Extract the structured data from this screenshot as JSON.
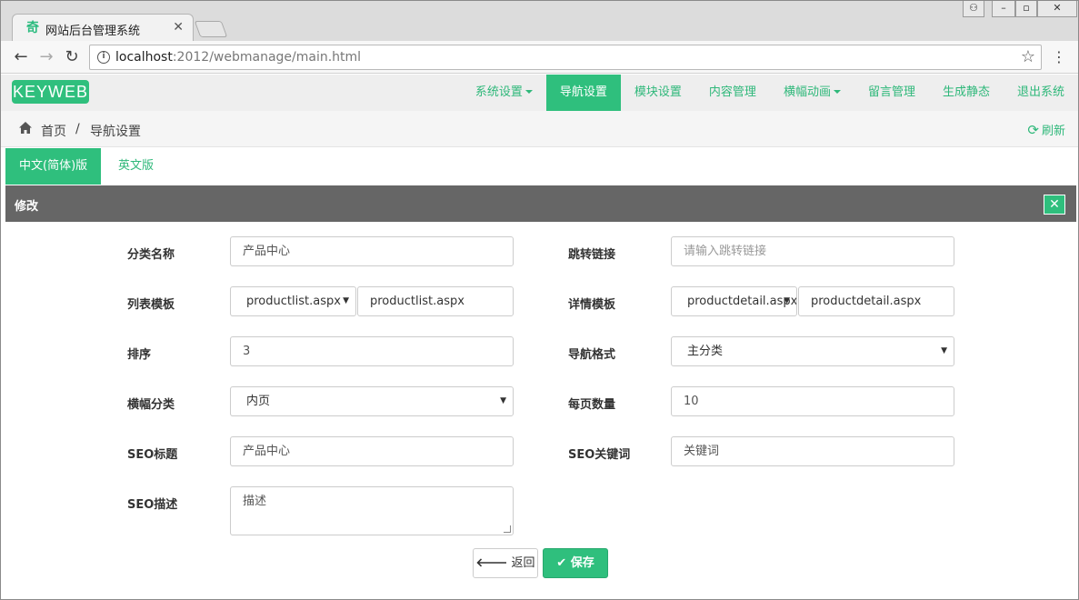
{
  "browser": {
    "tab_title": "网站后台管理系统",
    "url_host": "localhost",
    "url_path": ":2012/webmanage/main.html"
  },
  "app": {
    "logo": "KEYWEB",
    "menu": [
      {
        "label": "系统设置",
        "dropdown": true,
        "active": false
      },
      {
        "label": "导航设置",
        "dropdown": false,
        "active": true
      },
      {
        "label": "模块设置",
        "dropdown": false,
        "active": false
      },
      {
        "label": "内容管理",
        "dropdown": false,
        "active": false
      },
      {
        "label": "横幅动画",
        "dropdown": true,
        "active": false
      },
      {
        "label": "留言管理",
        "dropdown": false,
        "active": false
      },
      {
        "label": "生成静态",
        "dropdown": false,
        "active": false
      },
      {
        "label": "退出系统",
        "dropdown": false,
        "active": false
      }
    ],
    "accent_color": "#2fbf7d"
  },
  "breadcrumb": {
    "home": "首页",
    "separator": "/",
    "current": "导航设置",
    "refresh": "刷新"
  },
  "lang_tabs": [
    {
      "label": "中文(简体)版",
      "active": true
    },
    {
      "label": "英文版",
      "active": false
    }
  ],
  "panel": {
    "title": "修改"
  },
  "form": {
    "category_name": {
      "label": "分类名称",
      "value": "产品中心"
    },
    "redirect_link": {
      "label": "跳转链接",
      "placeholder": "请输入跳转链接"
    },
    "list_template": {
      "label": "列表模板",
      "selected": "productlist.aspx",
      "value": "productlist.aspx"
    },
    "detail_template": {
      "label": "详情模板",
      "selected": "productdetail.aspx",
      "value": "productdetail.aspx"
    },
    "sort": {
      "label": "排序",
      "value": "3"
    },
    "nav_style": {
      "label": "导航格式",
      "selected": "主分类"
    },
    "banner_category": {
      "label": "横幅分类",
      "selected": "内页"
    },
    "page_size": {
      "label": "每页数量",
      "value": "10"
    },
    "seo_title": {
      "label": "SEO标题",
      "value": "产品中心"
    },
    "seo_keywords": {
      "label": "SEO关键词",
      "value": "关键词"
    },
    "seo_description": {
      "label": "SEO描述",
      "value": "描述"
    }
  },
  "buttons": {
    "back": "返回",
    "save": "保存"
  }
}
